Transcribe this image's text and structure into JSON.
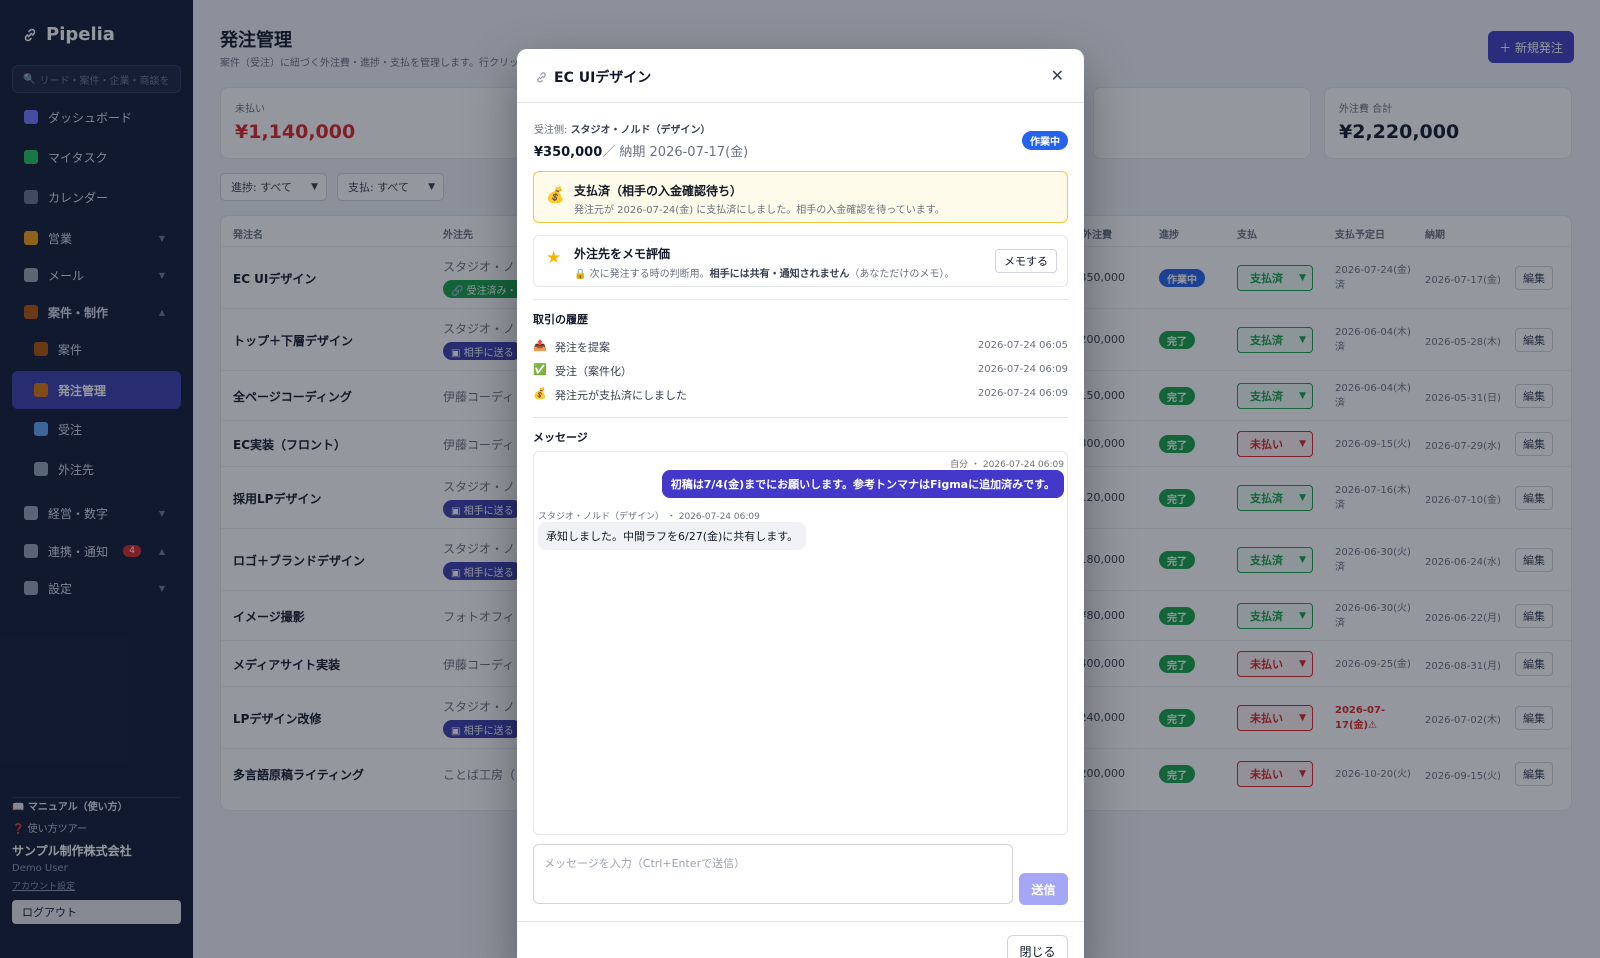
{
  "app": {
    "name": "Pipelia",
    "search_placeholder": "リード・案件・企業・商談を"
  },
  "sidebar": {
    "items": [
      {
        "label": "ダッシュボード",
        "icon": "chart-icon",
        "color": "#6d78ff"
      },
      {
        "label": "マイタスク",
        "icon": "check-icon",
        "color": "#22c55e"
      },
      {
        "label": "カレンダー",
        "icon": "calendar-icon",
        "color": "#64748b"
      },
      {
        "label": "営業",
        "icon": "megaphone-icon",
        "color": "#f59e0b"
      },
      {
        "label": "メール",
        "icon": "mail-icon",
        "color": "#9ca3af"
      },
      {
        "label": "案件・制作",
        "icon": "briefcase-icon",
        "color": "#b45309"
      },
      {
        "label": "案件",
        "icon": "briefcase-icon",
        "color": "#b45309"
      },
      {
        "label": "発注管理",
        "icon": "box-icon",
        "color": "#d97706"
      },
      {
        "label": "受注",
        "icon": "inbox-icon",
        "color": "#60a5fa"
      },
      {
        "label": "外注先",
        "icon": "factory-icon",
        "color": "#94a3b8"
      },
      {
        "label": "経営・数字",
        "icon": "trend-icon",
        "color": "#94a3b8"
      },
      {
        "label": "連携・通知",
        "icon": "link-icon",
        "color": "#94a3b8",
        "badge": "4"
      },
      {
        "label": "設定",
        "icon": "gear-icon",
        "color": "#94a3b8"
      }
    ],
    "footer": {
      "manual": "📖 マニュアル（使い方）",
      "tour": "❓ 使い方ツアー",
      "company": "サンプル制作株式会社",
      "user": "Demo User",
      "account": "アカウント設定",
      "logout": "ログアウト"
    }
  },
  "page": {
    "title": "発注管理",
    "subtitle": "案件（受注）に紐づく外注費・進捗・支払を管理します。行クリックで",
    "new_button": "＋ 新規発注",
    "stats": [
      {
        "label": "未払い",
        "value": "¥1,140,000",
        "color": "#dc2626"
      },
      {
        "label": "外注費 合計",
        "value": "¥2,220,000",
        "color": "#111827"
      }
    ],
    "filters": {
      "progress": "進捗: すべて",
      "payment": "支払: すべて"
    },
    "columns": {
      "name": "発注名",
      "vendor": "外注先",
      "cost": "外注費",
      "progress": "進捗",
      "payment": "支払",
      "due": "支払予定日",
      "deadline": "納期"
    },
    "edit_label": "編集",
    "rows": [
      {
        "name": "EC UIデザイン",
        "vendor": "スタジオ・ノ",
        "tag": "🔗 受注済み・",
        "tag_color": "green",
        "cost": "¥350,000",
        "status": "作業中",
        "status_kind": "wip",
        "pay": "支払済",
        "pay_kind": "paid",
        "due": "2026-07-24(金)",
        "due2": "済",
        "deadline": "2026-07-17(金)"
      },
      {
        "name": "トップ＋下層デザイン",
        "vendor": "スタジオ・ノ",
        "tag": "▣ 相手に送る",
        "tag_color": "indigo",
        "cost": "¥200,000",
        "status": "完了",
        "status_kind": "done",
        "pay": "支払済",
        "pay_kind": "paid",
        "due": "2026-06-04(木)",
        "due2": "済",
        "deadline": "2026-05-28(木)"
      },
      {
        "name": "全ページコーディング",
        "vendor": "伊藤コーディ",
        "tag": "",
        "tag_color": "",
        "cost": "¥150,000",
        "status": "完了",
        "status_kind": "done",
        "pay": "支払済",
        "pay_kind": "paid",
        "due": "2026-06-04(木)",
        "due2": "済",
        "deadline": "2026-05-31(日)"
      },
      {
        "name": "EC実装（フロント）",
        "vendor": "伊藤コーディ",
        "tag": "",
        "tag_color": "",
        "cost": "¥300,000",
        "status": "完了",
        "status_kind": "done",
        "pay": "未払い",
        "pay_kind": "unpaid",
        "due": "2026-09-15(火)",
        "due2": "",
        "deadline": "2026-07-29(水)"
      },
      {
        "name": "採用LPデザイン",
        "vendor": "スタジオ・ノ",
        "tag": "▣ 相手に送る",
        "tag_color": "indigo",
        "cost": "¥120,000",
        "status": "完了",
        "status_kind": "done",
        "pay": "支払済",
        "pay_kind": "paid",
        "due": "2026-07-16(木)",
        "due2": "済",
        "deadline": "2026-07-10(金)"
      },
      {
        "name": "ロゴ＋ブランドデザイン",
        "vendor": "スタジオ・ノ",
        "tag": "▣ 相手に送る",
        "tag_color": "indigo",
        "cost": "¥180,000",
        "status": "完了",
        "status_kind": "done",
        "pay": "支払済",
        "pay_kind": "paid",
        "due": "2026-06-30(火)",
        "due2": "済",
        "deadline": "2026-06-24(水)"
      },
      {
        "name": "イメージ撮影",
        "vendor": "フォトオフィ",
        "tag": "",
        "tag_color": "",
        "cost": "¥80,000",
        "status": "完了",
        "status_kind": "done",
        "pay": "支払済",
        "pay_kind": "paid",
        "due": "2026-06-30(火)",
        "due2": "済",
        "deadline": "2026-06-22(月)"
      },
      {
        "name": "メディアサイト実装",
        "vendor": "伊藤コーディ",
        "tag": "",
        "tag_color": "",
        "cost": "¥400,000",
        "status": "完了",
        "status_kind": "done",
        "pay": "未払い",
        "pay_kind": "unpaid",
        "due": "2026-09-25(金)",
        "due2": "",
        "deadline": "2026-08-31(月)"
      },
      {
        "name": "LPデザイン改修",
        "vendor": "スタジオ・ノ",
        "tag": "▣ 相手に送る",
        "tag_color": "indigo",
        "cost": "¥240,000",
        "status": "完了",
        "status_kind": "done",
        "pay": "未払い",
        "pay_kind": "unpaid",
        "due": "2026-07-",
        "due2": "17(金)⚠",
        "due_over": true,
        "deadline": "2026-07-02(木)"
      },
      {
        "name": "多言語原稿ライティング",
        "vendor": "ことば工房（",
        "tag": "",
        "tag_color": "",
        "cost": "¥200,000",
        "status": "完了",
        "status_kind": "done",
        "pay": "未払い",
        "pay_kind": "unpaid",
        "due": "2026-10-20(火)",
        "due2": "",
        "deadline": "2026-09-15(火)"
      }
    ]
  },
  "modal": {
    "title": "EC UIデザイン",
    "client_label": "受注側: ",
    "client_name": "スタジオ・ノルド（デザイン）",
    "price": "¥350,000",
    "deadline": "／ 納期 2026-07-17(金)",
    "status": "作業中",
    "alert_title": "支払済（相手の入金確認待ち）",
    "alert_text": "発注元が 2026-07-24(金) に支払済にしました。相手の入金確認を待っています。",
    "memo_title": "外注先をメモ評価",
    "memo_text_1": "次に発注する時の判断用。",
    "memo_text_bold": "相手には共有・通知されません",
    "memo_text_2": "（あなただけのメモ）。",
    "memo_button": "メモする",
    "history_title": "取引の履歴",
    "history": [
      {
        "icon": "📤",
        "text": "発注を提案",
        "time": "2026-07-24 06:05"
      },
      {
        "icon": "✅",
        "text": "受注（案件化）",
        "time": "2026-07-24 06:09"
      },
      {
        "icon": "💰",
        "text": "発注元が支払済にしました",
        "time": "2026-07-24 06:09"
      }
    ],
    "messages_title": "メッセージ",
    "messages": {
      "me_meta": "自分 ・ 2026-07-24 06:09",
      "me_text": "初稿は7/4(金)までにお願いします。参考トンマナはFigmaに追加済みです。",
      "them_meta": "スタジオ・ノルド（デザイン） ・ 2026-07-24 06:09",
      "them_text": "承知しました。中間ラフを6/27(金)に共有します。"
    },
    "input_placeholder": "メッセージを入力（Ctrl+Enterで送信）",
    "send_label": "送信",
    "close_label": "閉じる"
  }
}
